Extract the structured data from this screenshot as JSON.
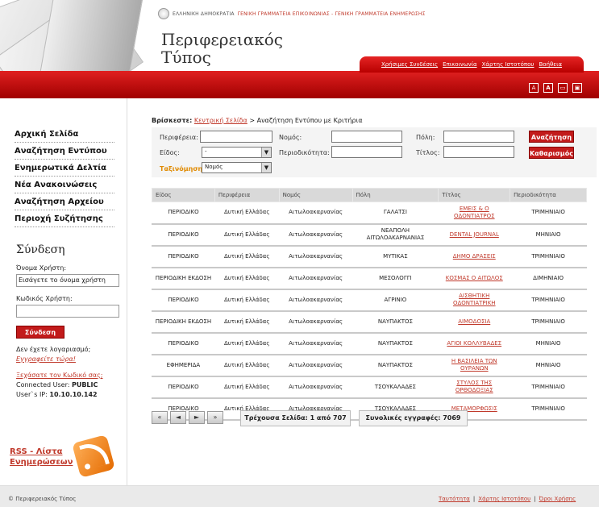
{
  "header": {
    "gov_line_1": "ΕΛΛΗΝΙΚΗ ΔΗΜΟΚΡΑΤΙΑ",
    "gov_line_2": "ΓΕΝΙΚΗ ΓΡΑΜΜΑΤΕΙΑ ΕΠΙΚΟΙΝΩΝΙΑΣ - ΓΕΝΙΚΗ ΓΡΑΜΜΑΤΕΙΑ ΕΝΗΜΕΡΩΣΗΣ",
    "title_line1": "Περιφερειακός",
    "title_line2": "Τύπος",
    "top_links": [
      "Χρήσιμες Συνδέσεις",
      "Επικοινωνία",
      "Χάρτης Ιστοτόπου",
      "Βοήθεια"
    ],
    "tool_icons": [
      "font-smaller-icon",
      "font-larger-icon",
      "print-icon",
      "save-icon"
    ]
  },
  "sidebar": {
    "nav": [
      "Αρχική Σελίδα",
      "Αναζήτηση Εντύπου",
      "Ενημερωτικά Δελτία",
      "Νέα Ανακοινώσεις",
      "Αναζήτηση Αρχείου",
      "Περιοχή Συζήτησης"
    ],
    "login": {
      "title": "Σύνδεση",
      "username_label": "Όνομα Χρήστη:",
      "username_placeholder": "Εισάγετε το όνομα χρήστη",
      "password_label": "Κωδικός Χρήστη:",
      "button": "Σύνδεση",
      "no_account": "Δεν έχετε λογαριασμό;",
      "register": "Εγγραφείτε τώρα!",
      "forgot": "Ξεχάσατε τον Κωδικό σας;",
      "connected_label": "Connected User:",
      "connected_value": "PUBLIC",
      "ip_label": "User`s IP:",
      "ip_value": "10.10.10.142"
    },
    "rss": {
      "line1": "RSS - Λίστα",
      "line2": "Ενημερώσεων"
    }
  },
  "breadcrumb": {
    "label": "Βρίσκεστε:",
    "home": "Κεντρική Σελίδα",
    "current": "> Αναζήτηση Εντύπου με Κριτήρια"
  },
  "filters": {
    "region_label": "Περιφέρεια:",
    "region_value": "",
    "prefecture_label": "Νομός:",
    "prefecture_value": "",
    "city_label": "Πόλη:",
    "city_value": "",
    "type_label": "Είδος:",
    "type_value": "-",
    "frequency_label": "Περιοδικότητα:",
    "frequency_value": "",
    "title_label": "Τίτλος:",
    "title_value": "",
    "sort_label": "Ταξινόμηση",
    "sort_value": "Νομός",
    "search_button": "Αναζήτηση",
    "clear_button": "Καθαρισμός"
  },
  "table": {
    "columns": [
      "Είδος",
      "Περιφέρεια",
      "Νομός",
      "Πόλη",
      "Τίτλος",
      "Περιοδικότητα"
    ],
    "rows": [
      [
        "ΠΕΡΙΟΔΙΚΟ",
        "Δυτική Ελλάδας",
        "Αιτωλοακαρνανίας",
        "ΓΑΛΑΤΣΙ",
        "ΕΜΕΙΣ & Ο ΟΔΟΝΤΙΑΤΡΟΣ",
        "ΤΡΙΜΗΝΙΑΙΟ"
      ],
      [
        "ΠΕΡΙΟΔΙΚΟ",
        "Δυτική Ελλάδας",
        "Αιτωλοακαρνανίας",
        "ΝΕΑΠΟΛΗ ΑΙΤΩΛΟΑΚΑΡΝΑΝΙΑΣ",
        "DENTAL JOURNAL",
        "ΜΗΝΙΑΙΟ"
      ],
      [
        "ΠΕΡΙΟΔΙΚΟ",
        "Δυτική Ελλάδας",
        "Αιτωλοακαρνανίας",
        "ΜΥΤΙΚΑΣ",
        "ΔΗΜΟ ΔΡΑΣΕΙΣ",
        "ΤΡΙΜΗΝΙΑΙΟ"
      ],
      [
        "ΠΕΡΙΟΔΙΚΗ ΕΚΔΟΣΗ",
        "Δυτική Ελλάδας",
        "Αιτωλοακαρνανίας",
        "ΜΕΣΟΛΟΓΓΙ",
        "ΚΟΣΜΑΣ Ο ΑΙΤΩΛΟΣ",
        "ΔΙΜΗΝΙΑΙΟ"
      ],
      [
        "ΠΕΡΙΟΔΙΚΟ",
        "Δυτική Ελλάδας",
        "Αιτωλοακαρνανίας",
        "ΑΓΡΙΝΙΟ",
        "ΑΙΣΘΗΤΙΚΗ ΟΔΟΝΤΙΑΤΡΙΚΗ",
        "ΤΡΙΜΗΝΙΑΙΟ"
      ],
      [
        "ΠΕΡΙΟΔΙΚΗ ΕΚΔΟΣΗ",
        "Δυτική Ελλάδας",
        "Αιτωλοακαρνανίας",
        "ΝΑΥΠΑΚΤΟΣ",
        "ΑΙΜΟΔΟΣΙΑ",
        "ΤΡΙΜΗΝΙΑΙΟ"
      ],
      [
        "ΠΕΡΙΟΔΙΚΟ",
        "Δυτική Ελλάδας",
        "Αιτωλοακαρνανίας",
        "ΝΑΥΠΑΚΤΟΣ",
        "ΑΓΙΟΙ ΚΟΛΛΥΒΑΔΕΣ",
        "ΜΗΝΙΑΙΟ"
      ],
      [
        "ΕΦΗΜΕΡΙΔΑ",
        "Δυτική Ελλάδας",
        "Αιτωλοακαρνανίας",
        "ΝΑΥΠΑΚΤΟΣ",
        "Η ΒΑΣΙΛΕΙΑ ΤΩΝ ΟΥΡΑΝΩΝ",
        "ΜΗΝΙΑΙΟ"
      ],
      [
        "ΠΕΡΙΟΔΙΚΟ",
        "Δυτική Ελλάδας",
        "Αιτωλοακαρνανίας",
        "ΤΣΟΥΚΑΛΑΔΕΣ",
        "ΣΤΥΛΟΣ ΤΗΣ ΟΡΘΟΔΟΞΙΑΣ",
        "ΤΡΙΜΗΝΙΑΙΟ"
      ],
      [
        "ΠΕΡΙΟΔΙΚΟ",
        "Δυτική Ελλάδας",
        "Αιτωλοακαρνανίας",
        "ΤΣΟΥΚΑΛΑΔΕΣ",
        "ΜΕΤΑΜΟΡΦΩΣΙΣ",
        "ΤΡΙΜΗΝΙΑΙΟ"
      ]
    ]
  },
  "pager": {
    "buttons": [
      "«",
      "◄",
      "►",
      "»"
    ],
    "current_page": "Τρέχουσα Σελίδα: 1 από 707",
    "total_records": "Συνολικές εγγραφές: 7069"
  },
  "footer": {
    "copyright": "© Περιφερειακός Τύπος",
    "links": [
      "Ταυτότητα",
      "Χάρτης Ιστοτόπου",
      "Όροι Χρήσης"
    ]
  }
}
